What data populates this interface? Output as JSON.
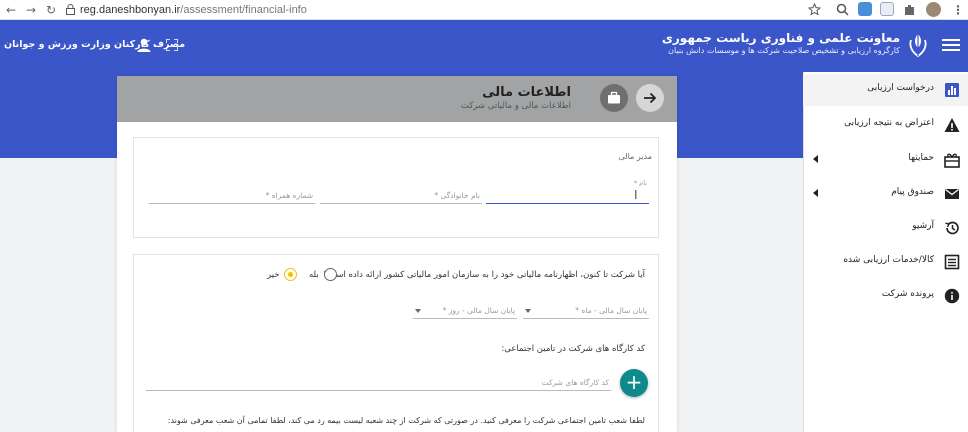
{
  "browser": {
    "url_domain": "reg.daneshbonyan.ir",
    "url_path": "/assessment/financial-info",
    "back_glyph": "←",
    "forward_glyph": "→",
    "reload_glyph": "↻"
  },
  "header": {
    "title": "معاونت علمی و فناوری ریاست جمهوری",
    "subtitle": "کارگروه ارزیابی و تشخیص صلاحیت شرکت ها و موسسات دانش بنیان",
    "user_name": "مصرف کارکنان وزارت ورزش و جوانان",
    "icons": [
      "menu-icon",
      "emblem-icon",
      "user-icon",
      "fullscreen-icon"
    ],
    "color": "#3a56c9"
  },
  "sidebar": {
    "items": [
      {
        "label": "درخواست ارزیابی",
        "icon": "bar-chart-icon",
        "active": true
      },
      {
        "label": "اعتراض به نتیجه ارزیابی",
        "icon": "warning-icon"
      },
      {
        "label": "حمایتها",
        "icon": "gift-icon",
        "has_submenu": true
      },
      {
        "label": "صندوق پیام",
        "icon": "mail-icon",
        "has_submenu": true
      },
      {
        "label": "آرشیو",
        "icon": "history-icon"
      },
      {
        "label": "کالا/خدمات ارزیابی شده",
        "icon": "list-icon"
      },
      {
        "label": "پرونده شرکت",
        "icon": "info-icon"
      }
    ]
  },
  "card": {
    "title": "اطلاعات مالی",
    "subtitle": "اطلاعات مالی و مالیاتی شرکت",
    "manager_section": {
      "label": "مدیر مالی",
      "fields": {
        "first_name": "نام *",
        "last_name": "نام خانوادگی *",
        "mobile": "شماره همراه *"
      }
    },
    "tax": {
      "question": "آیا شرکت تا کنون، اظهارنامه مالیاتی خود را به سازمان امور مالیاتی کشور ارائه داده است؟",
      "yes": "بله",
      "no": "خیر",
      "selected": "no",
      "fiscal_end_month": "پایان سال مالی - ماه *",
      "fiscal_end_day": "پایان سال مالی - روز *"
    },
    "workshop": {
      "label": "کد کارگاه های شرکت در تامین اجتماعی:",
      "placeholder": "کد کارگاه های شرکت",
      "add_symbol": "+"
    },
    "branch_note": "لطفا شعب تامین اجتماعی شرکت را معرفی کنید. در صورتی که شرکت از چند شعبه لیست بیمه رد می کند، لطفا تمامی آن شعب معرفی شوند:"
  },
  "colors": {
    "accent": "#3a56c9",
    "radio_selected": "#f5c000",
    "add_button": "#0f8a8a"
  }
}
